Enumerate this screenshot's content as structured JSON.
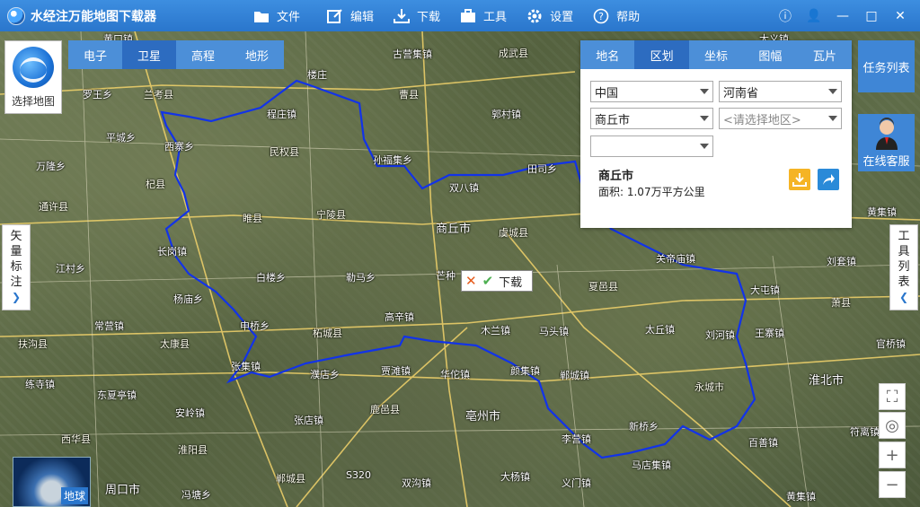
{
  "app": {
    "title": "水经注万能地图下载器"
  },
  "menu": [
    {
      "label": "文件",
      "icon": "folder-icon"
    },
    {
      "label": "编辑",
      "icon": "edit-icon"
    },
    {
      "label": "下载",
      "icon": "download-icon"
    },
    {
      "label": "工具",
      "icon": "toolbox-icon"
    },
    {
      "label": "设置",
      "icon": "gear-icon"
    },
    {
      "label": "帮助",
      "icon": "help-icon"
    }
  ],
  "map_tabs": [
    "电子",
    "卫星",
    "高程",
    "地形"
  ],
  "map_tab_active": "卫星",
  "select_map_label": "选择地图",
  "panel": {
    "tabs": [
      "地名",
      "区划",
      "坐标",
      "图幅",
      "瓦片"
    ],
    "active": "区划",
    "country": "中国",
    "province": "河南省",
    "city": "商丘市",
    "district_placeholder": "<请选择地区>",
    "town": "",
    "result_name": "商丘市",
    "result_area": "面积: 1.07万平方公里"
  },
  "task_list_label": "任务列表",
  "online_service_label": "在线客服",
  "left_side_tab": [
    "矢",
    "量",
    "标",
    "注"
  ],
  "right_side_tab": [
    "工",
    "具",
    "列",
    "表"
  ],
  "download_popup_label": "下载",
  "earth_label": "地球",
  "places": [
    {
      "t": "黄口镇"
    },
    {
      "t": "古营集镇"
    },
    {
      "t": "成武县",
      "c": "county"
    },
    {
      "t": "大义镇"
    },
    {
      "t": "新城镇"
    },
    {
      "t": "兰考县",
      "c": "county"
    },
    {
      "t": "罗王乡"
    },
    {
      "t": "楼庄"
    },
    {
      "t": "程庄镇"
    },
    {
      "t": "曹县",
      "c": "county"
    },
    {
      "t": "郭村镇"
    },
    {
      "t": "平城乡"
    },
    {
      "t": "西寨乡"
    },
    {
      "t": "民权县",
      "c": "county"
    },
    {
      "t": "孙福集乡"
    },
    {
      "t": "双八镇"
    },
    {
      "t": "田司乡"
    },
    {
      "t": "万隆乡"
    },
    {
      "t": "杞县",
      "c": "county"
    },
    {
      "t": "通许县",
      "c": "county"
    },
    {
      "t": "睢县",
      "c": "county"
    },
    {
      "t": "宁陵县",
      "c": "county"
    },
    {
      "t": "商丘市",
      "c": "city"
    },
    {
      "t": "虞城县",
      "c": "county"
    },
    {
      "t": "黄集镇"
    },
    {
      "t": "长岗镇"
    },
    {
      "t": "江村乡"
    },
    {
      "t": "白楼乡"
    },
    {
      "t": "勒马乡"
    },
    {
      "t": "芒种"
    },
    {
      "t": "关帝庙镇"
    },
    {
      "t": "刘套镇"
    },
    {
      "t": "杨庙乡"
    },
    {
      "t": "夏邑县",
      "c": "county"
    },
    {
      "t": "大屯镇"
    },
    {
      "t": "萧县",
      "c": "county"
    },
    {
      "t": "常营镇"
    },
    {
      "t": "申桥乡"
    },
    {
      "t": "柘城县",
      "c": "county"
    },
    {
      "t": "高辛镇"
    },
    {
      "t": "木兰镇"
    },
    {
      "t": "马头镇"
    },
    {
      "t": "太丘镇"
    },
    {
      "t": "刘河镇"
    },
    {
      "t": "王寨镇"
    },
    {
      "t": "扶沟县",
      "c": "county"
    },
    {
      "t": "太康县",
      "c": "county"
    },
    {
      "t": "张集镇"
    },
    {
      "t": "濮店乡"
    },
    {
      "t": "贾滩镇"
    },
    {
      "t": "华佗镇"
    },
    {
      "t": "颜集镇"
    },
    {
      "t": "官桥镇"
    },
    {
      "t": "练寺镇"
    },
    {
      "t": "郸城镇"
    },
    {
      "t": "永城市",
      "c": "county"
    },
    {
      "t": "淮北市",
      "c": "city"
    },
    {
      "t": "东夏亭镇"
    },
    {
      "t": "安岭镇"
    },
    {
      "t": "鹿邑县",
      "c": "county"
    },
    {
      "t": "亳州市",
      "c": "city"
    },
    {
      "t": "张店镇"
    },
    {
      "t": "新桥乡"
    },
    {
      "t": "符离镇"
    },
    {
      "t": "西华县",
      "c": "county"
    },
    {
      "t": "淮阳县",
      "c": "county"
    },
    {
      "t": "李营镇"
    },
    {
      "t": "百善镇"
    },
    {
      "t": "马店集镇"
    },
    {
      "t": "周口市",
      "c": "city"
    },
    {
      "t": "郸城县",
      "c": "county"
    },
    {
      "t": "大杨镇"
    },
    {
      "t": "双沟镇"
    },
    {
      "t": "义门镇"
    },
    {
      "t": "冯塘乡"
    },
    {
      "t": "黄集镇"
    },
    {
      "t": "S320"
    }
  ]
}
